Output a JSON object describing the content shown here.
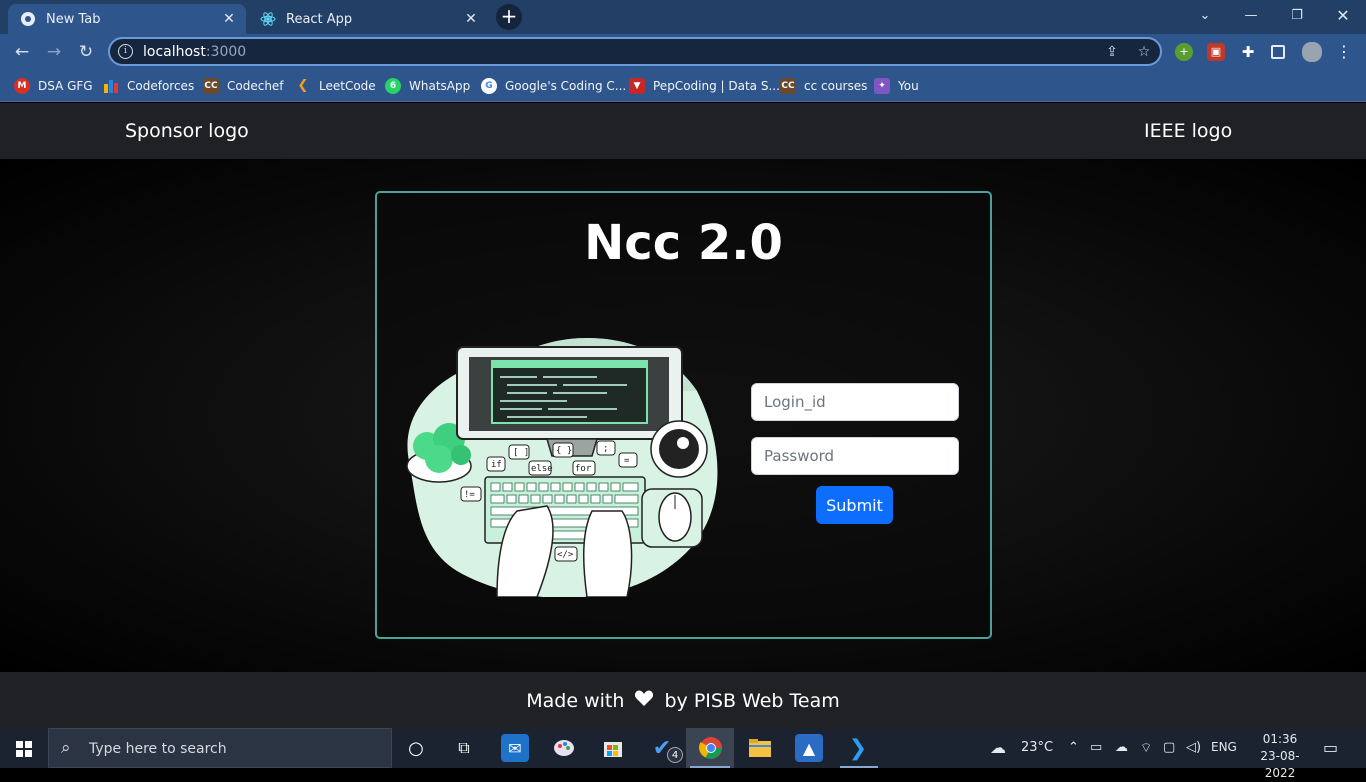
{
  "browser": {
    "tabs": [
      {
        "label": "New Tab",
        "active": true,
        "icon": "chrome-icon"
      },
      {
        "label": "React App",
        "active": false,
        "icon": "react-icon"
      }
    ],
    "new_tab_symbol": "+",
    "url_host": "localhost",
    "url_port": ":3000",
    "bookmarks": [
      {
        "label": "DSA GFG",
        "icon": "gmail-icon",
        "color": "#d93025"
      },
      {
        "label": "Codeforces",
        "icon": "codeforces-icon",
        "color": "#f4b400"
      },
      {
        "label": "Codechef",
        "icon": "cc-icon",
        "color": "#6b4a2b"
      },
      {
        "label": "LeetCode",
        "icon": "leetcode-icon",
        "color": "#f89f1b"
      },
      {
        "label": "WhatsApp",
        "icon": "whatsapp-icon",
        "color": "#25d366"
      },
      {
        "label": "Google's Coding C...",
        "icon": "google-icon",
        "color": "#4285f4"
      },
      {
        "label": "PepCoding | Data S...",
        "icon": "pepcoding-icon",
        "color": "#c62828"
      },
      {
        "label": "cc courses",
        "icon": "cc-icon",
        "color": "#6b4a2b"
      },
      {
        "label": "You",
        "icon": "you-icon",
        "color": "#7e57c2"
      }
    ]
  },
  "header": {
    "left_text": "Sponsor logo",
    "right_text": "IEEE logo"
  },
  "card": {
    "title": "Ncc 2.0",
    "login_placeholder": "Login_id",
    "password_placeholder": "Password",
    "submit_label": "Submit",
    "accent_color": "#4aa39a"
  },
  "footer": {
    "text_before": "Made with",
    "text_after": "by PISB Web Team"
  },
  "taskbar": {
    "search_placeholder": "Type here to search",
    "weather": "23°C",
    "language": "ENG",
    "time": "01:36",
    "date": "23-08-2022",
    "todo_badge": "4"
  }
}
